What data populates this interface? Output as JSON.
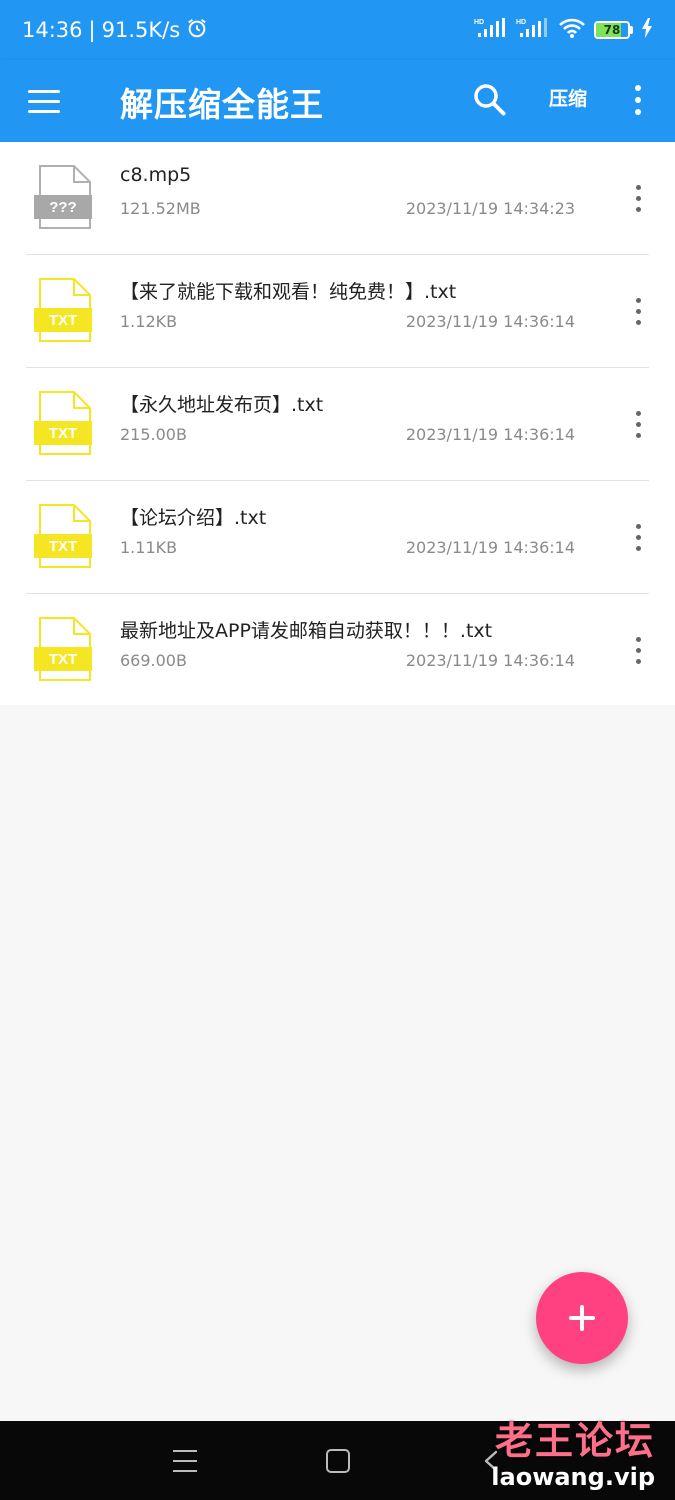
{
  "status_bar": {
    "time": "14:36",
    "speed": "91.5K/s",
    "battery": "78",
    "battery_level": 0.78
  },
  "app_bar": {
    "title": "解压缩全能王",
    "compress_label": "压缩"
  },
  "files": [
    {
      "name": "c8.mp5",
      "size": "121.52MB",
      "date": "2023/11/19 14:34:23",
      "type": "unknown",
      "badge": "???"
    },
    {
      "name": "【来了就能下载和观看！纯免费！】.txt",
      "size": "1.12KB",
      "date": "2023/11/19 14:36:14",
      "type": "txt",
      "badge": "TXT"
    },
    {
      "name": "【永久地址发布页】.txt",
      "size": "215.00B",
      "date": "2023/11/19 14:36:14",
      "type": "txt",
      "badge": "TXT"
    },
    {
      "name": "【论坛介绍】.txt",
      "size": "1.11KB",
      "date": "2023/11/19 14:36:14",
      "type": "txt",
      "badge": "TXT"
    },
    {
      "name": "最新地址及APP请发邮箱自动获取！！！.txt",
      "size": "669.00B",
      "date": "2023/11/19 14:36:14",
      "type": "txt",
      "badge": "TXT"
    }
  ],
  "watermark": {
    "cn": "老王论坛",
    "url": "laowang.vip"
  },
  "colors": {
    "primary": "#2196f3",
    "fab": "#ff4081",
    "txt_icon": "#f5e623",
    "unknown_icon": "#9e9e9e"
  }
}
